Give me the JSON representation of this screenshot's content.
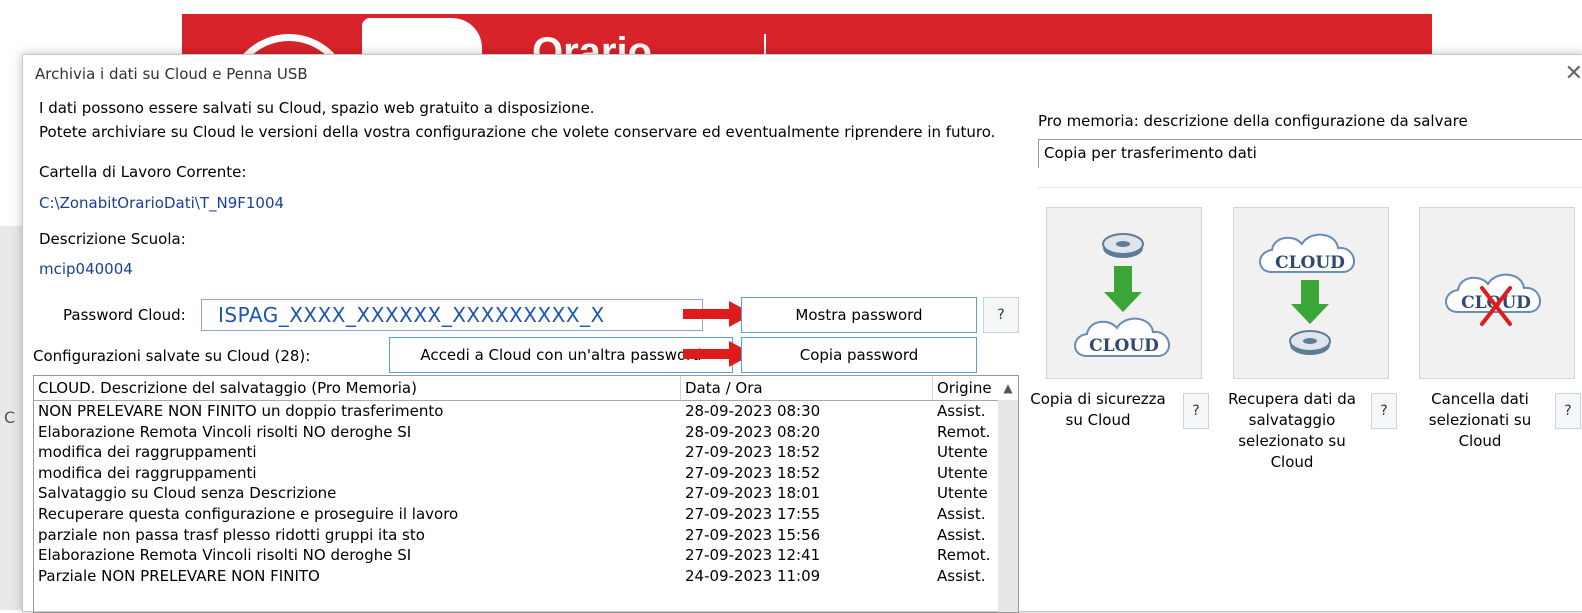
{
  "background": {
    "logo_text": "Orario",
    "side_char": "C"
  },
  "dialog": {
    "title": "Archivia i dati su Cloud e Penna USB",
    "close_glyph": "✕",
    "intro_line1": "I dati possono essere salvati su Cloud, spazio web gratuito a disposizione.",
    "intro_line2": "Potete archiviare su Cloud le versioni della vostra configurazione che volete conservare ed eventualmente riprendere in futuro.",
    "workdir_label": "Cartella di Lavoro Corrente:",
    "workdir_value": "C:\\ZonabitOrarioDati\\T_N9F1004",
    "school_label": "Descrizione Scuola:",
    "school_value": "mcip040004",
    "password_label": "Password Cloud:",
    "password_value": "ISPAG_XXXX_XXXXXX_XXXXXXXXX_X",
    "show_password_label": "Mostra password",
    "copy_password_label": "Copia password",
    "other_password_label": "Accedi a Cloud con un'altra password",
    "help_label": "?",
    "saved_configs_label": "Configurazioni salvate su Cloud (28):",
    "memo_label": "Pro memoria: descrizione della configurazione da salvare",
    "memo_value": "Copia per trasferimento dati"
  },
  "table": {
    "headers": [
      "CLOUD. Descrizione del salvataggio (Pro Memoria)",
      "Data / Ora",
      "Origine"
    ],
    "rows": [
      [
        "NON PRELEVARE NON FINITO un doppio trasferimento",
        "28-09-2023 08:30",
        "Assist."
      ],
      [
        "Elaborazione Remota Vincoli risolti NO  deroghe SI",
        "28-09-2023 08:20",
        "Remot."
      ],
      [
        "modifica dei raggruppamenti",
        "27-09-2023 18:52",
        "Utente"
      ],
      [
        "modifica dei raggruppamenti",
        "27-09-2023 18:52",
        "Utente"
      ],
      [
        "Salvataggio su Cloud senza Descrizione",
        "27-09-2023 18:01",
        "Utente"
      ],
      [
        "Recuperare questa configurazione e proseguire il lavoro",
        "27-09-2023 17:55",
        "Assist."
      ],
      [
        "parziale non passa trasf plesso ridotti gruppi ita sto",
        "27-09-2023 15:56",
        "Assist."
      ],
      [
        "Elaborazione Remota Vincoli risolti NO  deroghe SI",
        "27-09-2023 12:41",
        "Remot."
      ],
      [
        "Parziale  NON PRELEVARE NON FINITO",
        "24-09-2023 11:09",
        "Assist."
      ]
    ]
  },
  "actions": [
    {
      "label": "Copia di sicurezza su Cloud",
      "line1": "Copia di sicurezza",
      "line2": "su Cloud",
      "line3": ""
    },
    {
      "label": "Recupera dati da salvataggio selezionato su Cloud",
      "line1": "Recupera dati da",
      "line2": "salvataggio",
      "line3": "selezionato su",
      "line4": "Cloud"
    },
    {
      "label": "Cancella dati selezionati su Cloud",
      "line1": "Cancella dati",
      "line2": "selezionati su",
      "line3": "Cloud"
    }
  ],
  "icons": {
    "cloud_text": "CLOUD"
  },
  "colors": {
    "accent_blue": "#1b3f94",
    "banner_red": "#d8232a",
    "arrow_red": "#e01b1b",
    "arrow_green": "#3aa637"
  }
}
